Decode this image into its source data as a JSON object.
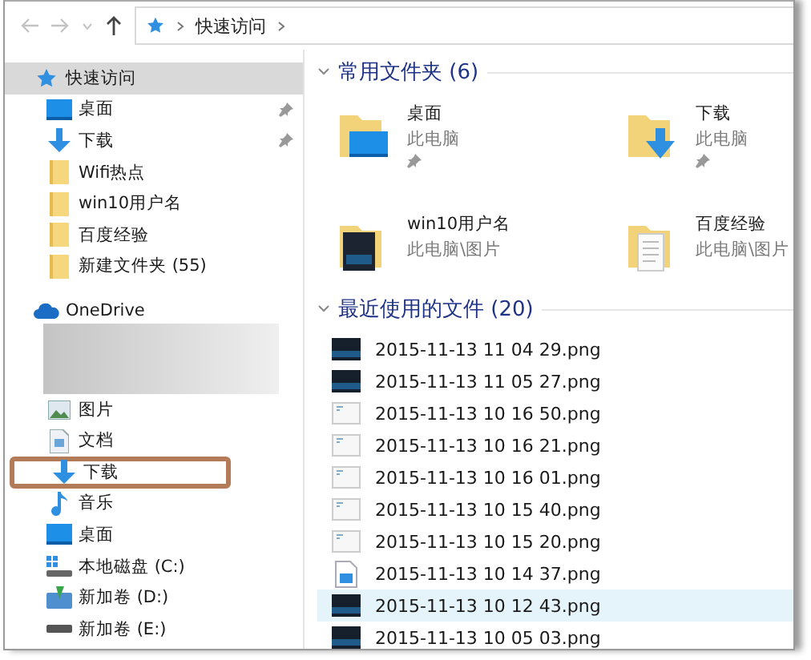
{
  "address_bar": {
    "path": [
      "快速访问"
    ]
  },
  "sidebar": {
    "items": [
      {
        "kind": "star",
        "label": "快速访问",
        "selected": true,
        "annotated": false,
        "children": [
          {
            "kind": "desktop",
            "label": "桌面",
            "pinned": true,
            "selected": false,
            "annotated": false
          },
          {
            "kind": "download",
            "label": "下载",
            "pinned": true,
            "selected": false,
            "annotated": false
          },
          {
            "kind": "folder",
            "label": "Wifi热点",
            "pinned": false,
            "selected": false,
            "annotated": false
          },
          {
            "kind": "folder",
            "label": "win10用户名",
            "pinned": false,
            "selected": false,
            "annotated": false
          },
          {
            "kind": "folder",
            "label": "百度经验",
            "pinned": false,
            "selected": false,
            "annotated": false
          },
          {
            "kind": "folder",
            "label": "新建文件夹 (55)",
            "pinned": false,
            "selected": false,
            "annotated": false
          }
        ]
      },
      {
        "kind": "cloud",
        "label": "OneDrive",
        "selected": false,
        "annotated": false
      }
    ],
    "pc_items": [
      {
        "kind": "pictures",
        "label": "图片",
        "selected": false,
        "annotated": false
      },
      {
        "kind": "documents",
        "label": "文档",
        "selected": false,
        "annotated": false
      },
      {
        "kind": "download",
        "label": "下载",
        "selected": false,
        "annotated": true
      },
      {
        "kind": "music",
        "label": "音乐",
        "selected": false,
        "annotated": false
      },
      {
        "kind": "desktop",
        "label": "桌面",
        "selected": false,
        "annotated": false
      },
      {
        "kind": "drive_c",
        "label": "本地磁盘 (C:)",
        "selected": false,
        "annotated": false
      },
      {
        "kind": "drive_d",
        "label": "新加卷 (D:)",
        "selected": false,
        "annotated": false
      },
      {
        "kind": "drive_e",
        "label": "新加卷 (E:)",
        "selected": false,
        "annotated": false
      }
    ]
  },
  "frequent_folders": {
    "title": "常用文件夹 (6)",
    "expanded": true,
    "items": [
      {
        "kind": "desktop",
        "name": "桌面",
        "location": "此电脑",
        "pinned": true
      },
      {
        "kind": "download",
        "name": "下载",
        "location": "此电脑",
        "pinned": true
      },
      {
        "kind": "photos",
        "name": "win10用户名",
        "location": "此电脑\\图片",
        "pinned": false
      },
      {
        "kind": "documents",
        "name": "百度经验",
        "location": "此电脑\\图片",
        "pinned": false
      }
    ]
  },
  "recent_files": {
    "title": "最近使用的文件 (20)",
    "expanded": true,
    "items": [
      {
        "kind": "dark",
        "name": "2015-11-13 11 04 29.png",
        "selected": false
      },
      {
        "kind": "dark",
        "name": "2015-11-13 11 05 27.png",
        "selected": false
      },
      {
        "kind": "light",
        "name": "2015-11-13 10 16 50.png",
        "selected": false
      },
      {
        "kind": "light",
        "name": "2015-11-13 10 16 21.png",
        "selected": false
      },
      {
        "kind": "light",
        "name": "2015-11-13 10 16 01.png",
        "selected": false
      },
      {
        "kind": "light",
        "name": "2015-11-13 10 15 40.png",
        "selected": false
      },
      {
        "kind": "light",
        "name": "2015-11-13 10 15 20.png",
        "selected": false
      },
      {
        "kind": "image",
        "name": "2015-11-13 10 14 37.png",
        "selected": false
      },
      {
        "kind": "dark",
        "name": "2015-11-13 10 12 43.png",
        "selected": true
      },
      {
        "kind": "dark",
        "name": "2015-11-13 10 05 03.png",
        "selected": false
      }
    ]
  }
}
